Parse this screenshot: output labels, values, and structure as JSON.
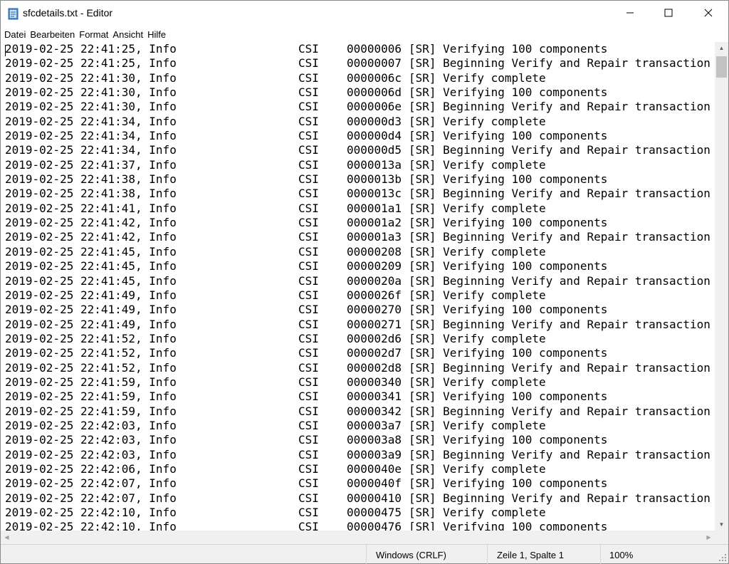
{
  "window": {
    "title": "sfcdetails.txt - Editor",
    "icon": "notepad-icon"
  },
  "menu": [
    {
      "label": "Datei"
    },
    {
      "label": "Bearbeiten"
    },
    {
      "label": "Format"
    },
    {
      "label": "Ansicht"
    },
    {
      "label": "Hilfe"
    }
  ],
  "lines": [
    {
      "ts": "2019-02-25 22:41:25, Info",
      "src": "CSI",
      "id": "00000006",
      "msg": "[SR] Verifying 100 components"
    },
    {
      "ts": "2019-02-25 22:41:25, Info",
      "src": "CSI",
      "id": "00000007",
      "msg": "[SR] Beginning Verify and Repair transaction"
    },
    {
      "ts": "2019-02-25 22:41:30, Info",
      "src": "CSI",
      "id": "0000006c",
      "msg": "[SR] Verify complete"
    },
    {
      "ts": "2019-02-25 22:41:30, Info",
      "src": "CSI",
      "id": "0000006d",
      "msg": "[SR] Verifying 100 components"
    },
    {
      "ts": "2019-02-25 22:41:30, Info",
      "src": "CSI",
      "id": "0000006e",
      "msg": "[SR] Beginning Verify and Repair transaction"
    },
    {
      "ts": "2019-02-25 22:41:34, Info",
      "src": "CSI",
      "id": "000000d3",
      "msg": "[SR] Verify complete"
    },
    {
      "ts": "2019-02-25 22:41:34, Info",
      "src": "CSI",
      "id": "000000d4",
      "msg": "[SR] Verifying 100 components"
    },
    {
      "ts": "2019-02-25 22:41:34, Info",
      "src": "CSI",
      "id": "000000d5",
      "msg": "[SR] Beginning Verify and Repair transaction"
    },
    {
      "ts": "2019-02-25 22:41:37, Info",
      "src": "CSI",
      "id": "0000013a",
      "msg": "[SR] Verify complete"
    },
    {
      "ts": "2019-02-25 22:41:38, Info",
      "src": "CSI",
      "id": "0000013b",
      "msg": "[SR] Verifying 100 components"
    },
    {
      "ts": "2019-02-25 22:41:38, Info",
      "src": "CSI",
      "id": "0000013c",
      "msg": "[SR] Beginning Verify and Repair transaction"
    },
    {
      "ts": "2019-02-25 22:41:41, Info",
      "src": "CSI",
      "id": "000001a1",
      "msg": "[SR] Verify complete"
    },
    {
      "ts": "2019-02-25 22:41:42, Info",
      "src": "CSI",
      "id": "000001a2",
      "msg": "[SR] Verifying 100 components"
    },
    {
      "ts": "2019-02-25 22:41:42, Info",
      "src": "CSI",
      "id": "000001a3",
      "msg": "[SR] Beginning Verify and Repair transaction"
    },
    {
      "ts": "2019-02-25 22:41:45, Info",
      "src": "CSI",
      "id": "00000208",
      "msg": "[SR] Verify complete"
    },
    {
      "ts": "2019-02-25 22:41:45, Info",
      "src": "CSI",
      "id": "00000209",
      "msg": "[SR] Verifying 100 components"
    },
    {
      "ts": "2019-02-25 22:41:45, Info",
      "src": "CSI",
      "id": "0000020a",
      "msg": "[SR] Beginning Verify and Repair transaction"
    },
    {
      "ts": "2019-02-25 22:41:49, Info",
      "src": "CSI",
      "id": "0000026f",
      "msg": "[SR] Verify complete"
    },
    {
      "ts": "2019-02-25 22:41:49, Info",
      "src": "CSI",
      "id": "00000270",
      "msg": "[SR] Verifying 100 components"
    },
    {
      "ts": "2019-02-25 22:41:49, Info",
      "src": "CSI",
      "id": "00000271",
      "msg": "[SR] Beginning Verify and Repair transaction"
    },
    {
      "ts": "2019-02-25 22:41:52, Info",
      "src": "CSI",
      "id": "000002d6",
      "msg": "[SR] Verify complete"
    },
    {
      "ts": "2019-02-25 22:41:52, Info",
      "src": "CSI",
      "id": "000002d7",
      "msg": "[SR] Verifying 100 components"
    },
    {
      "ts": "2019-02-25 22:41:52, Info",
      "src": "CSI",
      "id": "000002d8",
      "msg": "[SR] Beginning Verify and Repair transaction"
    },
    {
      "ts": "2019-02-25 22:41:59, Info",
      "src": "CSI",
      "id": "00000340",
      "msg": "[SR] Verify complete"
    },
    {
      "ts": "2019-02-25 22:41:59, Info",
      "src": "CSI",
      "id": "00000341",
      "msg": "[SR] Verifying 100 components"
    },
    {
      "ts": "2019-02-25 22:41:59, Info",
      "src": "CSI",
      "id": "00000342",
      "msg": "[SR] Beginning Verify and Repair transaction"
    },
    {
      "ts": "2019-02-25 22:42:03, Info",
      "src": "CSI",
      "id": "000003a7",
      "msg": "[SR] Verify complete"
    },
    {
      "ts": "2019-02-25 22:42:03, Info",
      "src": "CSI",
      "id": "000003a8",
      "msg": "[SR] Verifying 100 components"
    },
    {
      "ts": "2019-02-25 22:42:03, Info",
      "src": "CSI",
      "id": "000003a9",
      "msg": "[SR] Beginning Verify and Repair transaction"
    },
    {
      "ts": "2019-02-25 22:42:06, Info",
      "src": "CSI",
      "id": "0000040e",
      "msg": "[SR] Verify complete"
    },
    {
      "ts": "2019-02-25 22:42:07, Info",
      "src": "CSI",
      "id": "0000040f",
      "msg": "[SR] Verifying 100 components"
    },
    {
      "ts": "2019-02-25 22:42:07, Info",
      "src": "CSI",
      "id": "00000410",
      "msg": "[SR] Beginning Verify and Repair transaction"
    },
    {
      "ts": "2019-02-25 22:42:10, Info",
      "src": "CSI",
      "id": "00000475",
      "msg": "[SR] Verify complete"
    },
    {
      "ts": "2019-02-25 22:42:10, Info",
      "src": "CSI",
      "id": "00000476",
      "msg": "[SR] Verifying 100 components"
    }
  ],
  "status": {
    "encoding": "Windows (CRLF)",
    "position": "Zeile 1, Spalte 1",
    "zoom": "100%"
  },
  "icons": {
    "minimize": "minimize-icon",
    "maximize": "maximize-icon",
    "close": "close-icon"
  }
}
